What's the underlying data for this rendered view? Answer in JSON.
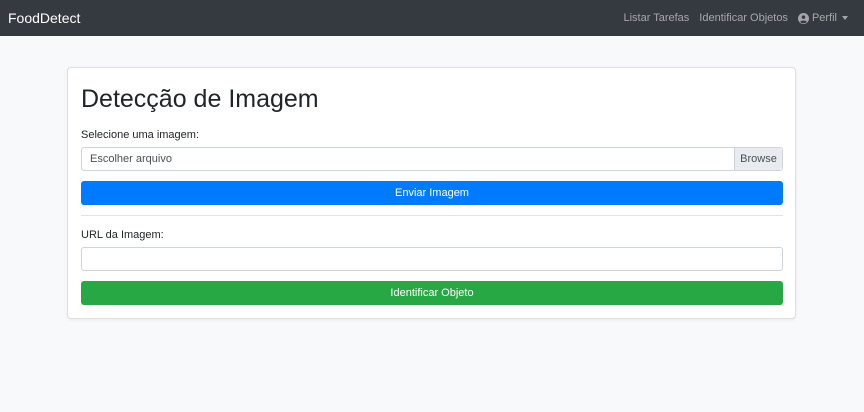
{
  "navbar": {
    "brand": "FoodDetect",
    "links": [
      "Listar Tarefas",
      "Identificar Objetos"
    ],
    "profile_label": "Perfil",
    "profile_icon": "user-circle-icon"
  },
  "card": {
    "title": "Detecção de Imagem",
    "file_label": "Selecione uma imagem:",
    "file_placeholder": "Escolher arquivo",
    "browse_label": "Browse",
    "upload_button": "Enviar Imagem",
    "url_label": "URL da Imagem:",
    "url_value": "",
    "identify_button": "Identificar Objeto"
  },
  "colors": {
    "navbar_bg": "#343a40",
    "primary": "#007bff",
    "success": "#28a745",
    "page_bg": "#f8f9fa"
  }
}
